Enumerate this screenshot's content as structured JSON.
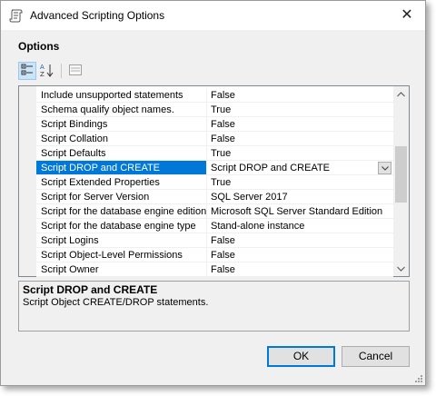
{
  "window": {
    "title": "Advanced Scripting Options",
    "close_glyph": "✕"
  },
  "options_heading": "Options",
  "toolbar": {
    "categorized_icon": "categorized-icon",
    "alphabetical_icon": "sort-alphabetical-icon",
    "property_pages_icon": "property-pages-icon"
  },
  "grid": {
    "rows": [
      {
        "name": "Include unsupported statements",
        "value": "False"
      },
      {
        "name": "Schema qualify object names.",
        "value": "True"
      },
      {
        "name": "Script Bindings",
        "value": "False"
      },
      {
        "name": "Script Collation",
        "value": "False"
      },
      {
        "name": "Script Defaults",
        "value": "True"
      },
      {
        "name": "Script DROP and CREATE",
        "value": "Script DROP and CREATE",
        "selected": true
      },
      {
        "name": "Script Extended Properties",
        "value": "True"
      },
      {
        "name": "Script for Server Version",
        "value": "SQL Server 2017"
      },
      {
        "name": "Script for the database engine edition",
        "value": "Microsoft SQL Server Standard Edition"
      },
      {
        "name": "Script for the database engine type",
        "value": "Stand-alone instance"
      },
      {
        "name": "Script Logins",
        "value": "False"
      },
      {
        "name": "Script Object-Level Permissions",
        "value": "False"
      },
      {
        "name": "Script Owner",
        "value": "False"
      }
    ]
  },
  "description": {
    "title": "Script DROP and CREATE",
    "text": "Script Object CREATE/DROP statements."
  },
  "buttons": {
    "ok": "OK",
    "cancel": "Cancel"
  },
  "colors": {
    "selection": "#0078d7",
    "window_bg": "#f0f0f0"
  }
}
